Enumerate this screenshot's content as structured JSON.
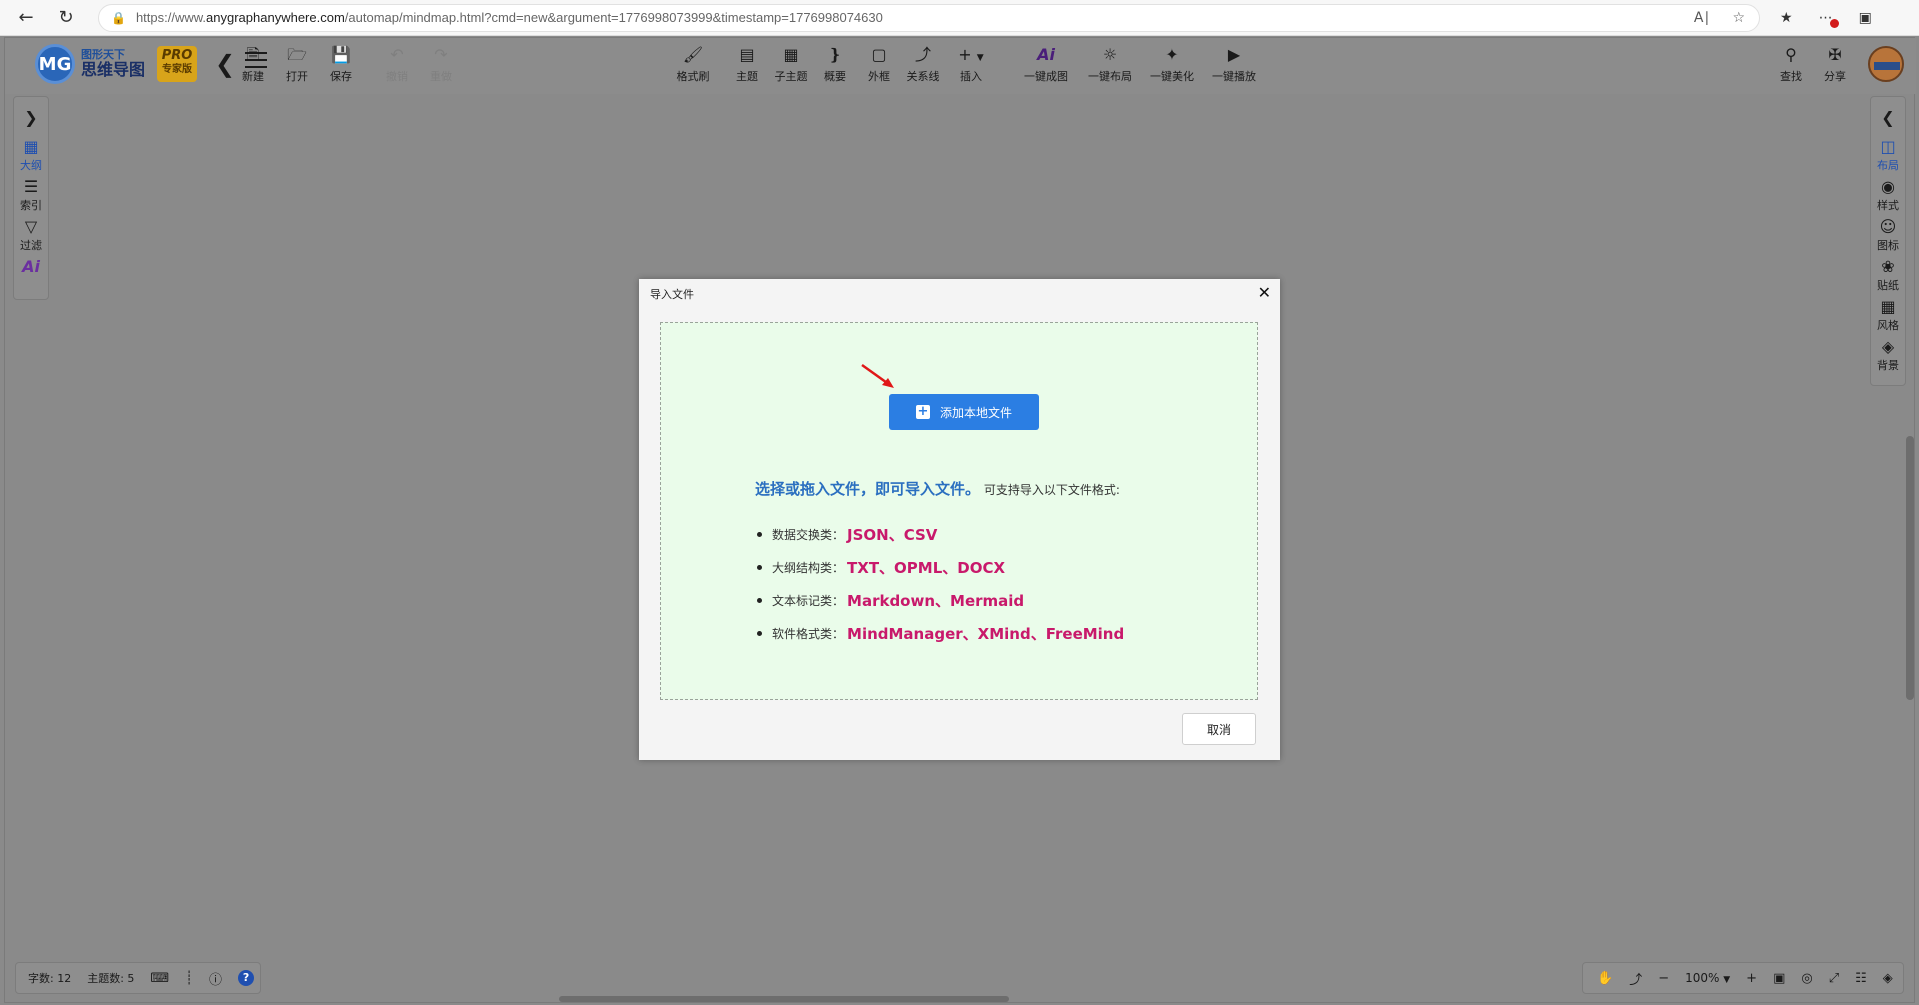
{
  "browser": {
    "url_prefix": "https://www.",
    "url_domain": "anygraphanywhere.com",
    "url_rest": "/automap/mindmap.html?cmd=new&argument=1776998073999&timestamp=1776998074630"
  },
  "app": {
    "logo_circle": "MG",
    "logo_top": "图形天下",
    "logo_main": "思维导图",
    "pro_badge_top": "PRO",
    "pro_badge_bottom": "专家版"
  },
  "toolbar": {
    "new": "新建",
    "open": "打开",
    "save": "保存",
    "undo": "撤销",
    "redo": "重做",
    "format_brush": "格式刷",
    "topic": "主题",
    "subtopic": "子主题",
    "summary": "概要",
    "boundary": "外框",
    "relation": "关系线",
    "insert": "插入",
    "ai_generate": "一键成图",
    "ai_layout": "一键布局",
    "ai_beautify": "一键美化",
    "ai_play": "一键播放",
    "find": "查找",
    "share": "分享"
  },
  "left_panel": {
    "outline": "大纲",
    "index": "索引",
    "filter": "过滤",
    "ai": "Ai"
  },
  "right_panel": {
    "layout": "布局",
    "style": "样式",
    "icon": "图标",
    "sticker": "贴纸",
    "theme": "风格",
    "background": "背景"
  },
  "status": {
    "word_count": "字数: 12",
    "topic_count": "主题数: 5",
    "zoom": "100%"
  },
  "dialog": {
    "title": "导入文件",
    "add_button": "添加本地文件",
    "lead_strong": "选择或拖入文件，即可导入文件。",
    "lead_rest": "可支持导入以下文件格式:",
    "formats": [
      {
        "category": "数据交换类：",
        "values": "JSON、CSV"
      },
      {
        "category": "大纲结构类：",
        "values": "TXT、OPML、DOCX"
      },
      {
        "category": "文本标记类：",
        "values": "Markdown、Mermaid"
      },
      {
        "category": "软件格式类：",
        "values": "MindManager、XMind、FreeMind"
      }
    ],
    "cancel": "取消"
  },
  "colors": {
    "accent": "#2b7ee3",
    "format_highlight": "#c8196b",
    "lead_text": "#2b6fc0",
    "dropzone_bg": "#eafcea"
  }
}
